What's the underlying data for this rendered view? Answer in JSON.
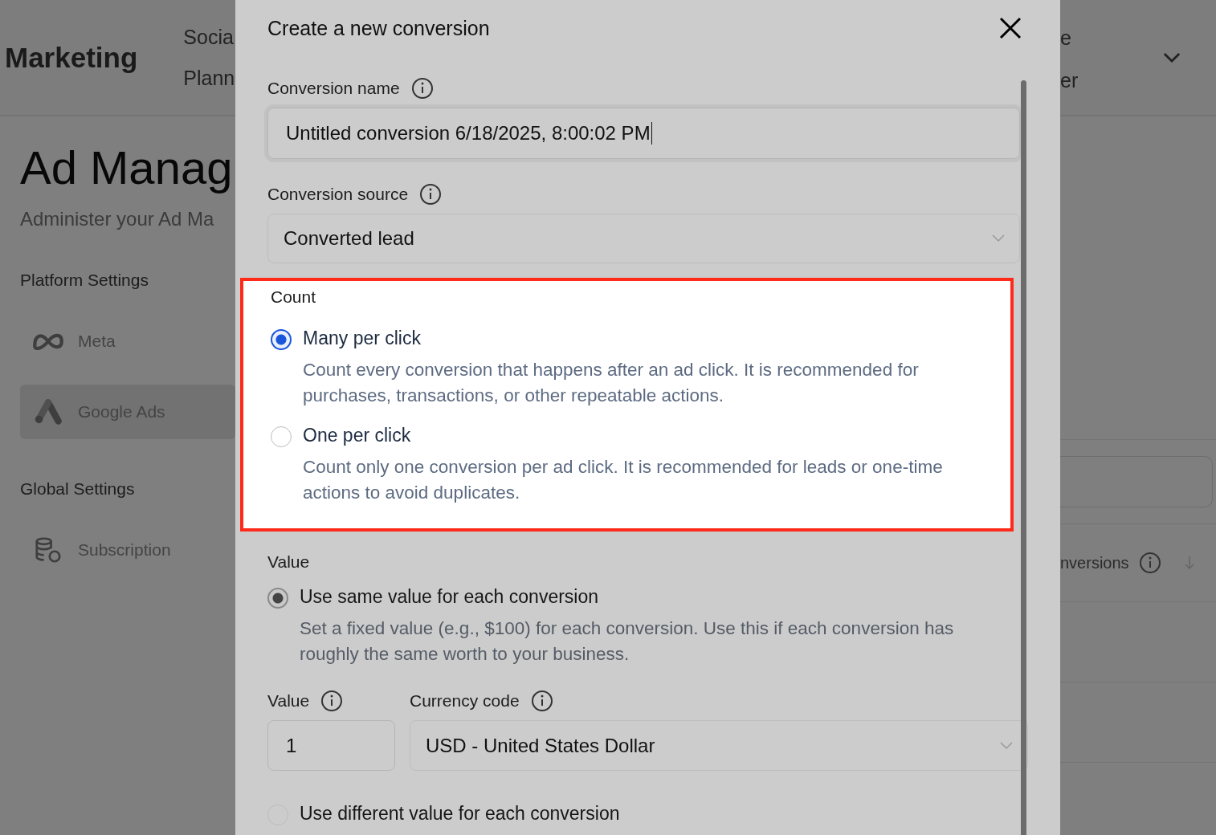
{
  "header": {
    "title": "Marketing",
    "nav_left": [
      "Socia",
      "Plann"
    ],
    "nav_right": [
      "e",
      "er"
    ]
  },
  "page": {
    "title": "Ad Manag",
    "subtitle": "Administer your Ad Ma"
  },
  "sidebar": {
    "sections": [
      {
        "heading": "Platform Settings",
        "items": [
          {
            "label": "Meta",
            "kind": "meta",
            "selected": false
          },
          {
            "label": "Google Ads",
            "kind": "ads",
            "selected": true
          }
        ]
      },
      {
        "heading": "Global Settings",
        "items": [
          {
            "label": "Subscription",
            "kind": "coins",
            "selected": false
          }
        ]
      }
    ]
  },
  "table": {
    "column_partial": "nversions"
  },
  "modal": {
    "title": "Create a new conversion",
    "name_field": {
      "label": "Conversion name",
      "value": "Untitled conversion 6/18/2025, 8:00:02 PM"
    },
    "source_field": {
      "label": "Conversion source",
      "value": "Converted lead"
    },
    "count": {
      "heading": "Count",
      "highlighted": true,
      "options": [
        {
          "label": "Many per click",
          "description": "Count every conversion that happens after an ad click. It is recommended for purchases, transactions, or other repeatable actions.",
          "selected": true
        },
        {
          "label": "One per click",
          "description": "Count only one conversion per ad click. It is recommended for leads or one-time actions to avoid duplicates.",
          "selected": false
        }
      ]
    },
    "value": {
      "heading": "Value",
      "options": [
        {
          "label": "Use same value for each conversion",
          "description": "Set a fixed value (e.g., $100) for each conversion. Use this if each conversion has roughly the same worth to your business.",
          "selected": true
        },
        {
          "label": "Use different value for each conversion",
          "selected": false
        }
      ],
      "value_field": {
        "label": "Value",
        "value": "1"
      },
      "currency_field": {
        "label": "Currency code",
        "value": "USD - United States Dollar"
      }
    }
  }
}
